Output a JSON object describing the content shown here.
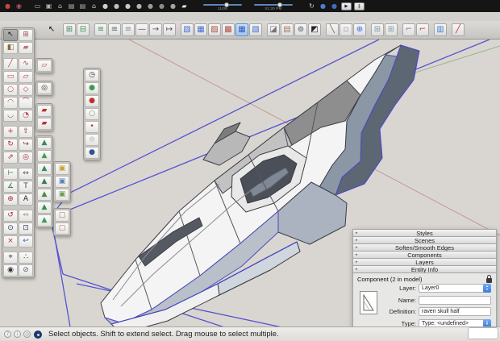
{
  "titlebar": {
    "left_icons": [
      {
        "name": "red-sphere-icon",
        "glyph": "●",
        "color": "#c04545",
        "cls": "tb-ic glyph"
      },
      {
        "name": "red-blue-orbit-icon",
        "glyph": "◉",
        "color": "#b05868",
        "cls": "tb-ic glyph"
      }
    ],
    "gray_icons": [
      {
        "name": "trackpad-icon",
        "glyph": "▭",
        "color": "#b9b9b9",
        "cls": "tb-ic glyph"
      },
      {
        "name": "box-icon",
        "glyph": "▣",
        "color": "#b0b0b0",
        "cls": "tb-ic glyph"
      },
      {
        "name": "home-icon",
        "glyph": "⌂",
        "color": "#c4c4c4",
        "cls": "tb-ic glyph"
      },
      {
        "name": "folder-open-icon",
        "glyph": "▤",
        "color": "#b5b5b5",
        "cls": "tb-ic glyph"
      },
      {
        "name": "folder-icon",
        "glyph": "▤",
        "color": "#ababab",
        "cls": "tb-ic glyph"
      },
      {
        "name": "home-outline-icon",
        "glyph": "⌂",
        "color": "#d0d0d0",
        "cls": "tb-ic glyph"
      }
    ],
    "sphere_icons": [
      {
        "name": "style-sphere-1-icon",
        "glyph": "●",
        "color": "#cfcfcf",
        "cls": "tb-ic glyph"
      },
      {
        "name": "style-sphere-2-icon",
        "glyph": "●",
        "color": "#bfbfbf",
        "cls": "tb-ic glyph"
      },
      {
        "name": "style-sphere-3-icon",
        "glyph": "●",
        "color": "#c8c8c8",
        "cls": "tb-ic glyph"
      },
      {
        "name": "style-sphere-4-icon",
        "glyph": "●",
        "color": "#b2b2b2",
        "cls": "tb-ic glyph"
      },
      {
        "name": "style-sphere-5-icon",
        "glyph": "●",
        "color": "#999999",
        "cls": "tb-ic glyph"
      },
      {
        "name": "style-sphere-6-icon",
        "glyph": "●",
        "color": "#8a8a8a",
        "cls": "tb-ic glyph"
      },
      {
        "name": "style-sphere-7-icon",
        "glyph": "●",
        "color": "#a3a3a3",
        "cls": "tb-ic glyph"
      }
    ],
    "soap_icon": {
      "name": "eraser-soap-icon",
      "glyph": "▰",
      "color": "#e8e8e8"
    },
    "sliders": [
      {
        "label": "11/08",
        "name": "shadow-date-slider"
      },
      {
        "label": "01:30 PM",
        "name": "shadow-time-slider"
      }
    ],
    "right_icons": [
      {
        "name": "sync-icon",
        "glyph": "↻",
        "color": "#cfcfcf",
        "cls": "tb-ic glyph"
      },
      {
        "name": "blue-sphere-1-icon",
        "glyph": "●",
        "color": "#4a7fd0",
        "cls": "tb-ic glyph"
      },
      {
        "name": "blue-sphere-2-icon",
        "glyph": "●",
        "color": "#3a6fc0",
        "cls": "tb-ic glyph"
      }
    ],
    "play_label": "▶",
    "pause_label": "‖"
  },
  "toolbar": {
    "buttons": [
      {
        "name": "select-arrow-icon",
        "glyph": "↖",
        "color": "#111111",
        "cls": "btn plain glyph"
      },
      {
        "name": "component-green-add-icon",
        "glyph": "⊞",
        "color": "#3d8b4f",
        "cls": "btn sp glyph"
      },
      {
        "name": "component-green-edit-icon",
        "glyph": "⊟",
        "color": "#3d8b4f",
        "cls": "btn glyph"
      },
      {
        "name": "edge-lines-green-icon",
        "glyph": "≡",
        "color": "#3d8b4f",
        "cls": "btn sp glyph"
      },
      {
        "name": "edge-lines-arrow-icon",
        "glyph": "≡",
        "color": "#556677",
        "cls": "btn glyph"
      },
      {
        "name": "edge-lines-dim-icon",
        "glyph": "≡",
        "color": "#8a8a8a",
        "cls": "btn glyph"
      },
      {
        "name": "edge-single-line-icon",
        "glyph": "—",
        "color": "#555555",
        "cls": "btn glyph"
      },
      {
        "name": "edge-line-arrow-icon",
        "glyph": "→",
        "color": "#555555",
        "cls": "btn glyph"
      },
      {
        "name": "edge-line-end-icon",
        "glyph": "↦",
        "color": "#555555",
        "cls": "btn glyph"
      },
      {
        "name": "hatch-diagonal-icon",
        "glyph": "▧",
        "color": "#4a6fd0",
        "cls": "btn sp glyph"
      },
      {
        "name": "hatch-cross-blue-icon",
        "glyph": "▦",
        "color": "#4a6fd0",
        "cls": "btn glyph"
      },
      {
        "name": "hatch-cross-red-icon",
        "glyph": "▨",
        "color": "#b05545",
        "cls": "btn glyph"
      },
      {
        "name": "hatch-dense-red-icon",
        "glyph": "▩",
        "color": "#b05545",
        "cls": "btn glyph"
      },
      {
        "name": "hatch-dense-blue-icon",
        "glyph": "▦",
        "color": "#2f62c4",
        "cls": "btn active glyph"
      },
      {
        "name": "hatch-diag-blue-icon",
        "glyph": "▧",
        "color": "#4a6fd0",
        "cls": "btn glyph"
      },
      {
        "name": "sketchy-page-icon",
        "glyph": "◪",
        "color": "#777777",
        "cls": "btn sp glyph"
      },
      {
        "name": "materials-stack-icon",
        "glyph": "▤",
        "color": "#a0795a",
        "cls": "btn glyph"
      },
      {
        "name": "photo-camera-icon",
        "glyph": "⊚",
        "color": "#555566",
        "cls": "btn glyph"
      },
      {
        "name": "checker-bw-icon",
        "glyph": "◩",
        "color": "#222222",
        "cls": "btn glyph"
      },
      {
        "name": "key-tool-icon",
        "glyph": "╲",
        "color": "#776644",
        "cls": "btn sp glyph"
      },
      {
        "name": "grid-faint-icon",
        "glyph": "▫",
        "color": "#999999",
        "cls": "btn glyph"
      },
      {
        "name": "web-globe-icon",
        "glyph": "⊕",
        "color": "#3a6fd8",
        "cls": "btn glyph"
      },
      {
        "name": "window-grid-1-icon",
        "glyph": "⊞",
        "color": "#8899aa",
        "cls": "btn sp glyph"
      },
      {
        "name": "window-grid-2-icon",
        "glyph": "⊞",
        "color": "#8899aa",
        "cls": "btn glyph"
      },
      {
        "name": "line-tag-icon",
        "glyph": "⌐",
        "color": "#667788",
        "cls": "btn sp glyph"
      },
      {
        "name": "line-marker-red-icon",
        "glyph": "⌐",
        "color": "#bb3333",
        "cls": "btn glyph"
      },
      {
        "name": "window-header-blue-icon",
        "glyph": "▥",
        "color": "#4a7fd0",
        "cls": "btn sp glyph"
      },
      {
        "name": "red-pencil-icon",
        "glyph": "╱",
        "color": "#cc2222",
        "cls": "btn sp glyph"
      }
    ]
  },
  "tool_palette": {
    "tools": [
      {
        "name": "tool-select-icon",
        "glyph": "↖",
        "color": "#111111",
        "cls": "cell active glyph"
      },
      {
        "name": "tool-make-component-icon",
        "glyph": "⊞",
        "color": "#a05050",
        "cls": "cell glyph"
      },
      {
        "name": "tool-paint-bucket-icon",
        "glyph": "◧",
        "color": "#8a6a3a",
        "cls": "cell glyph"
      },
      {
        "name": "tool-eraser-icon",
        "glyph": "▰",
        "color": "#c07070",
        "cls": "cell glyph"
      },
      {
        "name": "tool-line-icon",
        "glyph": "╱",
        "color": "#b03a4a",
        "cls": "cell gap glyph"
      },
      {
        "name": "tool-freehand-icon",
        "glyph": "∿",
        "color": "#b03a4a",
        "cls": "cell gap glyph"
      },
      {
        "name": "tool-rectangle-icon",
        "glyph": "▭",
        "color": "#b04055",
        "cls": "cell glyph"
      },
      {
        "name": "tool-rotated-rectangle-icon",
        "glyph": "▱",
        "color": "#b04055",
        "cls": "cell glyph"
      },
      {
        "name": "tool-circle-icon",
        "glyph": "○",
        "color": "#b04055",
        "cls": "cell glyph"
      },
      {
        "name": "tool-polygon-icon",
        "glyph": "◇",
        "color": "#b04055",
        "cls": "cell glyph"
      },
      {
        "name": "tool-arc-icon",
        "glyph": "◠",
        "color": "#b04055",
        "cls": "cell glyph"
      },
      {
        "name": "tool-two-point-arc-icon",
        "glyph": "⌒",
        "color": "#b04055",
        "cls": "cell glyph"
      },
      {
        "name": "tool-three-point-arc-icon",
        "glyph": "◡",
        "color": "#b04055",
        "cls": "cell glyph"
      },
      {
        "name": "tool-pie-icon",
        "glyph": "◔",
        "color": "#b04055",
        "cls": "cell glyph"
      },
      {
        "name": "tool-move-icon",
        "glyph": "+",
        "color": "#c02020",
        "cls": "cell gap glyph"
      },
      {
        "name": "tool-push-pull-icon",
        "glyph": "⇧",
        "color": "#8a3030",
        "cls": "cell gap glyph"
      },
      {
        "name": "tool-rotate-icon",
        "glyph": "↻",
        "color": "#c02020",
        "cls": "cell glyph"
      },
      {
        "name": "tool-follow-me-icon",
        "glyph": "↪",
        "color": "#8a3030",
        "cls": "cell glyph"
      },
      {
        "name": "tool-scale-icon",
        "glyph": "⇗",
        "color": "#a03030",
        "cls": "cell glyph"
      },
      {
        "name": "tool-offset-icon",
        "glyph": "◎",
        "color": "#a03030",
        "cls": "cell glyph"
      },
      {
        "name": "tool-tape-measure-icon",
        "glyph": "⊢",
        "color": "#3c7a46",
        "cls": "cell gap glyph"
      },
      {
        "name": "tool-dimensions-icon",
        "glyph": "↔",
        "color": "#555555",
        "cls": "cell gap glyph"
      },
      {
        "name": "tool-protractor-icon",
        "glyph": "∡",
        "color": "#3c7a46",
        "cls": "cell glyph"
      },
      {
        "name": "tool-text-icon",
        "glyph": "T",
        "color": "#444444",
        "cls": "cell glyph"
      },
      {
        "name": "tool-axes-icon",
        "glyph": "⊕",
        "color": "#b03030",
        "cls": "cell glyph"
      },
      {
        "name": "tool-3d-text-icon",
        "glyph": "A",
        "color": "#222222",
        "cls": "cell glyph"
      },
      {
        "name": "tool-orbit-icon",
        "glyph": "↺",
        "color": "#b03030",
        "cls": "cell gap glyph"
      },
      {
        "name": "tool-pan-icon",
        "glyph": "⇔",
        "color": "#c09060",
        "cls": "cell gap glyph"
      },
      {
        "name": "tool-zoom-icon",
        "glyph": "⊙",
        "color": "#334466",
        "cls": "cell glyph"
      },
      {
        "name": "tool-zoom-window-icon",
        "glyph": "⊡",
        "color": "#334466",
        "cls": "cell glyph"
      },
      {
        "name": "tool-zoom-extents-icon",
        "glyph": "×",
        "color": "#c03030",
        "cls": "cell glyph"
      },
      {
        "name": "tool-previous-icon",
        "glyph": "↩",
        "color": "#3366bb",
        "cls": "cell glyph"
      },
      {
        "name": "tool-position-camera-icon",
        "glyph": "⌖",
        "color": "#333333",
        "cls": "cell gap glyph"
      },
      {
        "name": "tool-walk-icon",
        "glyph": "∴",
        "color": "#333333",
        "cls": "cell gap glyph"
      },
      {
        "name": "tool-look-around-icon",
        "glyph": "◉",
        "color": "#333333",
        "cls": "cell glyph"
      },
      {
        "name": "tool-section-plane-icon",
        "glyph": "⊘",
        "color": "#556677",
        "cls": "cell glyph"
      }
    ]
  },
  "camera_palette": [
    {
      "name": "clock-icon",
      "glyph": "◷",
      "color": "#333333",
      "cls": "cell glyph"
    },
    {
      "name": "green-globe-icon",
      "glyph": "●",
      "color": "#3d9b50",
      "cls": "cell glyph"
    },
    {
      "name": "red-globe-icon",
      "glyph": "●",
      "color": "#c03030",
      "cls": "cell glyph"
    },
    {
      "name": "white-globe-icon",
      "glyph": "○",
      "color": "#888888",
      "cls": "cell glyph"
    },
    {
      "name": "red-marker-icon",
      "glyph": "•",
      "color": "#c03030",
      "cls": "cell glyph"
    },
    {
      "name": "white-sphere-icon",
      "glyph": "●",
      "color": "#d8d8d8",
      "cls": "cell glyph"
    },
    {
      "name": "blue-helmet-icon",
      "glyph": "●",
      "color": "#33519b",
      "cls": "cell glyph"
    }
  ],
  "views_palette": [
    {
      "name": "iso-cube-yellow-icon",
      "glyph": "▣",
      "color": "#c8a22a",
      "cls": "cell glyph"
    },
    {
      "name": "iso-cube-blue-icon",
      "glyph": "▣",
      "color": "#5a7fb5",
      "cls": "cell glyph"
    },
    {
      "name": "iso-cube-green-icon",
      "glyph": "▣",
      "color": "#6a9a4a",
      "cls": "cell glyph"
    }
  ],
  "dialog_palette": [
    {
      "name": "dialog-bubble-1-icon",
      "glyph": "▢",
      "color": "#b06868",
      "cls": "cell glyph"
    },
    {
      "name": "dialog-bubble-2-icon",
      "glyph": "▢",
      "color": "#b06868",
      "cls": "cell glyph"
    }
  ],
  "quad_palette": [
    {
      "name": "quad-face-tool-icon",
      "glyph": "▱",
      "color": "#b05545",
      "cls": "cell glyph"
    }
  ],
  "circle_palette": [
    {
      "name": "circle-target-tool-icon",
      "glyph": "◎",
      "color": "#333333",
      "cls": "cell glyph"
    }
  ],
  "red_palette": [
    {
      "name": "red-plane-1-icon",
      "glyph": "▰",
      "color": "#c03030",
      "cls": "cell glyph"
    },
    {
      "name": "red-plane-2-icon",
      "glyph": "▰",
      "color": "#c03030",
      "cls": "cell glyph"
    }
  ],
  "sandbox_palette": [
    {
      "name": "sandbox-from-contours-icon",
      "glyph": "▲",
      "color": "#3d8b4f",
      "cls": "cell glyph"
    },
    {
      "name": "sandbox-from-scratch-icon",
      "glyph": "▲",
      "color": "#4d9b4f",
      "cls": "cell glyph"
    },
    {
      "name": "sandbox-smoove-icon",
      "glyph": "▲",
      "color": "#3d8b5f",
      "cls": "cell glyph"
    },
    {
      "name": "sandbox-stamp-icon",
      "glyph": "▲",
      "color": "#3d7b4f",
      "cls": "cell glyph"
    },
    {
      "name": "sandbox-drape-icon",
      "glyph": "▲",
      "color": "#4d8b3f",
      "cls": "cell glyph"
    },
    {
      "name": "sandbox-add-detail-icon",
      "glyph": "▲",
      "color": "#3d8b4f",
      "cls": "cell glyph"
    },
    {
      "name": "sandbox-flip-edge-icon",
      "glyph": "▲",
      "color": "#3d9b5f",
      "cls": "cell glyph"
    }
  ],
  "tray": {
    "bars": [
      {
        "label": "Styles",
        "name": "panel-bar-styles"
      },
      {
        "label": "Scenes",
        "name": "panel-bar-scenes"
      },
      {
        "label": "Soften/Smooth Edges",
        "name": "panel-bar-soften-smooth-edges"
      },
      {
        "label": "Components",
        "name": "panel-bar-components"
      },
      {
        "label": "Layers",
        "name": "panel-bar-layers"
      },
      {
        "label": "Entity Info",
        "name": "panel-bar-entity-info"
      }
    ],
    "entity_info": {
      "header": "Component (2 in model)",
      "layer_label": "Layer:",
      "layer_value": "Layer0",
      "name_label": "Name:",
      "name_value": "",
      "definition_label": "Definition:",
      "definition_value": "raven skull half",
      "type_label": "Type:",
      "type_value": "Type: <undefined>"
    }
  },
  "statusbar": {
    "icons": [
      {
        "name": "help-circle-icon",
        "glyph": "?"
      },
      {
        "name": "instructor-circle-icon",
        "glyph": "i"
      },
      {
        "name": "geolocation-circle-icon",
        "glyph": "◎"
      }
    ],
    "message": "Select objects. Shift to extend select. Drag mouse to select multiple.",
    "measurements_value": ""
  },
  "colors": {
    "selection_blue": "#4745d2",
    "accent_blue": "#3f7de0",
    "viewport_bg": "#d9d6d1",
    "red_axis": "#c49a93",
    "green_axis": "#9bb08f"
  }
}
